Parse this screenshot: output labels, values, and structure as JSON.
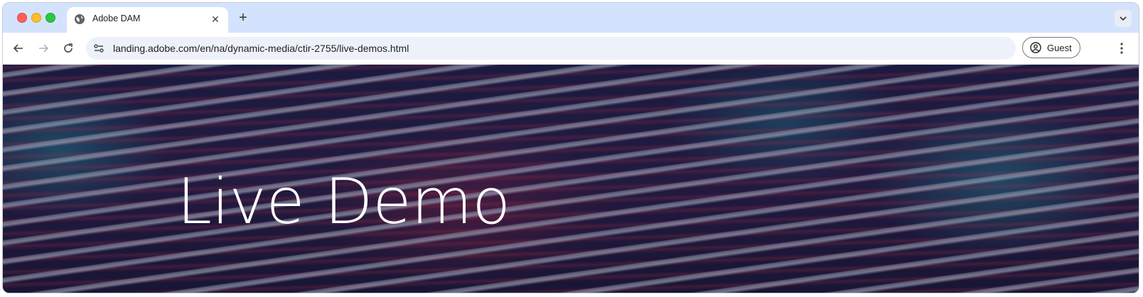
{
  "browser": {
    "tab": {
      "title": "Adobe DAM",
      "favicon": "globe-icon",
      "close_icon": "close-icon"
    },
    "new_tab_icon": "plus-icon",
    "tab_search_icon": "chevron-down-icon",
    "nav": {
      "back_icon": "arrow-left-icon",
      "forward_icon": "arrow-right-icon",
      "reload_icon": "reload-icon"
    },
    "address_bar": {
      "url": "landing.adobe.com/en/na/dynamic-media/ctir-2755/live-demos.html",
      "site_info_icon": "tune-icon"
    },
    "profile": {
      "label": "Guest",
      "icon": "account-circle-icon"
    },
    "menu_icon": "more-vert-icon",
    "colors": {
      "tabstrip": "#d3e3fd",
      "omnibox": "#edf2fa",
      "traffic_red": "#ff5f57",
      "traffic_yellow": "#febc2e",
      "traffic_green": "#28c840"
    }
  },
  "page": {
    "hero": {
      "title": "Live Demo",
      "title_color": "#ffffff"
    }
  }
}
